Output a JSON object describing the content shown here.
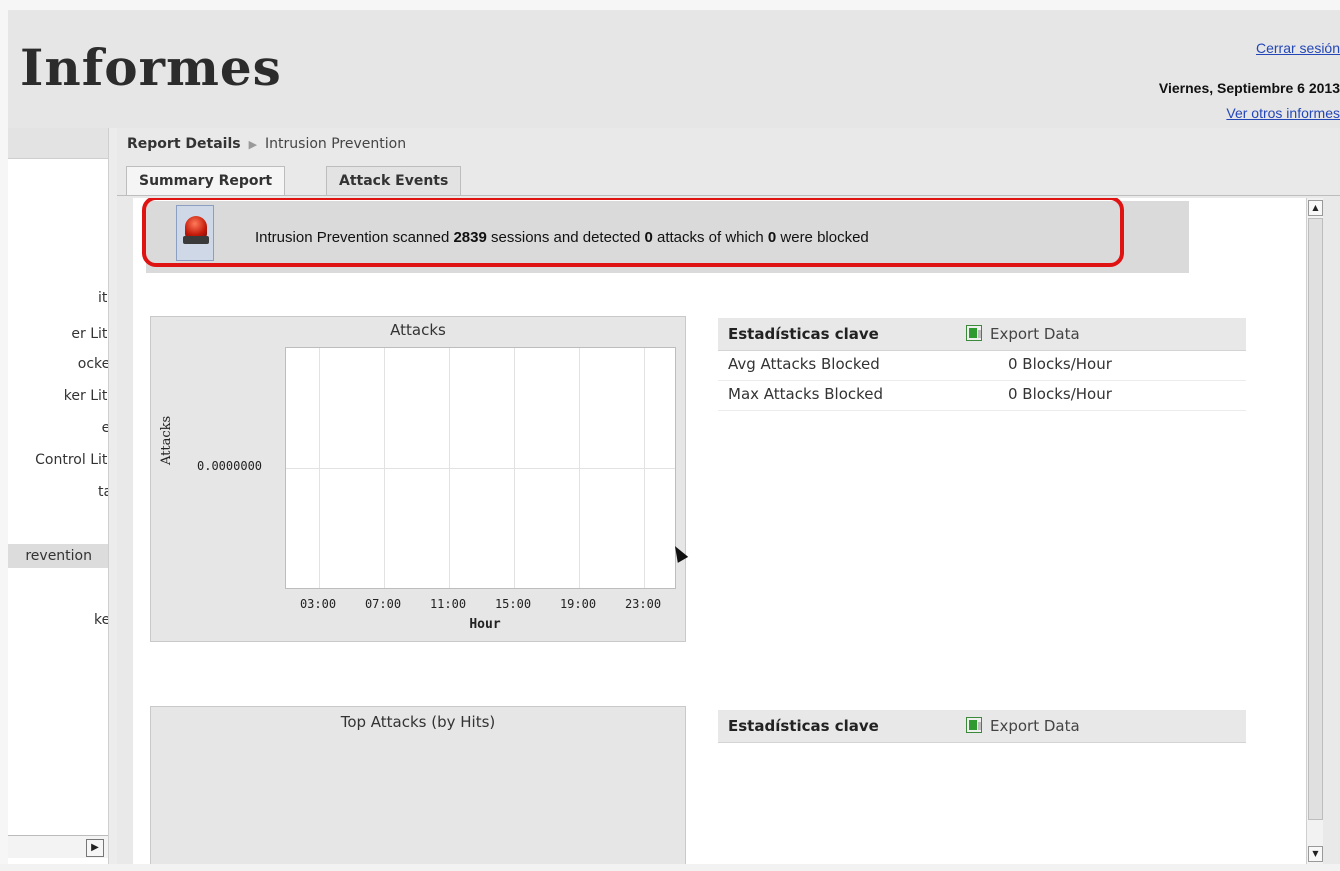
{
  "header": {
    "title": "Informes",
    "logout_label": "Cerrar sesión",
    "date": "Viernes, Septiembre 6 2013",
    "other_reports_label": "Ver otros informes"
  },
  "sidebar": {
    "items": [
      {
        "label": "ite"
      },
      {
        "label": "er Lite"
      },
      {
        "label": "ocker"
      },
      {
        "label": "ker Lite"
      },
      {
        "label": "er"
      },
      {
        "label": "Control Lite"
      },
      {
        "label": "tal"
      },
      {
        "label": "revention",
        "active": true
      },
      {
        "label": "ker"
      }
    ]
  },
  "breadcrumb": {
    "root": "Report Details",
    "current": "Intrusion Prevention"
  },
  "tabs": [
    {
      "label": "Summary Report",
      "active": true
    },
    {
      "label": "Attack Events",
      "active": false
    }
  ],
  "summary": {
    "prefix": "Intrusion Prevention scanned",
    "sessions": "2839",
    "mid": "sessions and detected",
    "attacks": "0",
    "mid2": "attacks of which",
    "blocked": "0",
    "suffix": "were blocked",
    "icon": "alarm-siren-icon",
    "highlight_color": "#e01313"
  },
  "chart_data": {
    "type": "line",
    "title": "Attacks",
    "xlabel": "Hour",
    "ylabel": "Attacks",
    "x_ticks": [
      "03:00",
      "07:00",
      "11:00",
      "15:00",
      "19:00",
      "23:00"
    ],
    "y_ticks": [
      "0.0000000"
    ],
    "series": [],
    "grid": true
  },
  "stats": {
    "title": "Estadísticas clave",
    "export_label": "Export Data",
    "rows": [
      {
        "label": "Avg Attacks Blocked",
        "value": "0 Blocks/Hour"
      },
      {
        "label": "Max Attacks Blocked",
        "value": "0 Blocks/Hour"
      }
    ]
  },
  "chart2": {
    "title": "Top Attacks (by Hits)"
  },
  "stats2": {
    "title": "Estadísticas clave",
    "export_label": "Export Data"
  }
}
